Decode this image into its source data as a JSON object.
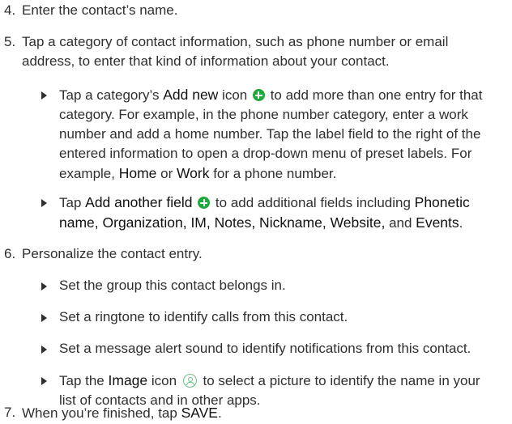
{
  "steps": {
    "s4": {
      "num": "4.",
      "text": "Enter the contact’s name."
    },
    "s5": {
      "num": "5.",
      "line1": "Tap a category of contact information, such as phone number or email",
      "line2": "address, to enter that kind of information about your contact."
    },
    "s6": {
      "num": "6.",
      "text": "Personalize the contact entry."
    },
    "s7": {
      "num": "7.",
      "pre": "When you’re finished, tap ",
      "bold": "SAVE",
      "post": "."
    }
  },
  "bullets": {
    "add_new": {
      "l1_pre": "Tap a category’s ",
      "l1_bold": "Add new",
      "l1_mid": " icon ",
      "l1_post": " to add more than one entry for that",
      "l2": "category. For example, in the phone number category, enter a work",
      "l3": "number and add a home number. Tap the label field to the right of the",
      "l4": "entered information to open a drop-down menu of preset labels. For",
      "l5_pre": "example, ",
      "l5_b1": "Home",
      "l5_mid": " or ",
      "l5_b2": "Work",
      "l5_post": " for a phone number."
    },
    "add_field": {
      "l1_pre": "Tap ",
      "l1_bold": "Add another field",
      "l1_post": " to add additional fields including ",
      "l1_bold2": "Phonetic",
      "l2_b1": "name, Organization, IM, Notes, Nickname, Website,",
      "l2_mid": " and ",
      "l2_b2": "Events",
      "l2_post": "."
    },
    "group": {
      "text": "Set the group this contact belongs in."
    },
    "ringtone": {
      "text": "Set a ringtone to identify calls from this contact."
    },
    "message_alert": {
      "text": "Set a message alert sound to identify notifications from this contact."
    },
    "image": {
      "l1_pre": "Tap the ",
      "l1_bold": "Image",
      "l1_mid": " icon ",
      "l1_post": " to select a picture to identify the name in your",
      "l2": "list of contacts and in other apps."
    }
  },
  "icons": {
    "add_new": "plus-circle-icon",
    "add_field": "plus-circle-icon",
    "image": "contact-image-icon"
  },
  "colors": {
    "text": "#2f2f2f",
    "icon_green": "#1fa83b",
    "image_icon": "#6fbf8a"
  }
}
